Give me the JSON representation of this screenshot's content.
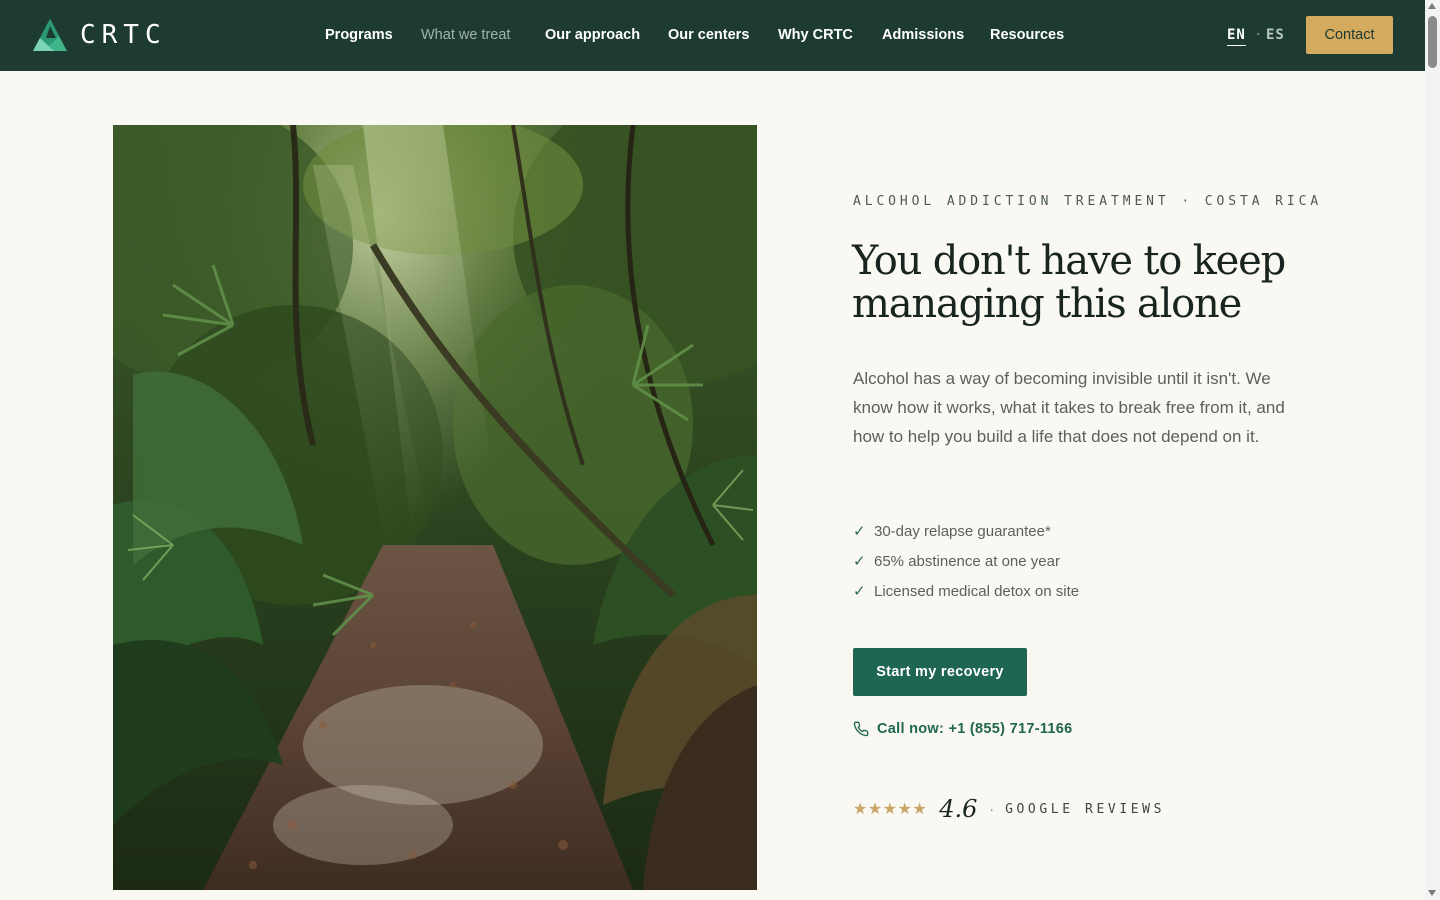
{
  "brand": {
    "name": "CRTC",
    "logo_icon": "leaf-triangle-logo-icon"
  },
  "nav": {
    "items": [
      {
        "label": "Programs",
        "state": "normal"
      },
      {
        "label": "What we treat",
        "state": "muted"
      },
      {
        "label": "Our approach",
        "state": "normal"
      },
      {
        "label": "Our centers",
        "state": "normal"
      },
      {
        "label": "Why CRTC",
        "state": "normal"
      },
      {
        "label": "Admissions",
        "state": "normal"
      },
      {
        "label": "Resources",
        "state": "normal"
      }
    ],
    "language": {
      "active": "EN",
      "separator": "·",
      "other": "ES"
    },
    "contact_label": "Contact"
  },
  "hero": {
    "image": {
      "description_icon": "jungle-path-photo"
    },
    "eyebrow": "ALCOHOL ADDICTION TREATMENT · COSTA RICA",
    "headline": "You don't have to keep managing this alone",
    "intro": "Alcohol has a way of becoming invisible until it isn't. We know how it works, what it takes to break free from it, and how to help you build a life that does not depend on it.",
    "checklist": [
      {
        "icon": "check-icon",
        "text": "30-day relapse guarantee*"
      },
      {
        "icon": "check-icon",
        "text": "65% abstinence at one year"
      },
      {
        "icon": "check-icon",
        "text": "Licensed medical detox on site"
      }
    ],
    "cta_label": "Start my recovery",
    "call": {
      "icon": "phone-icon",
      "label": "Call now: +1 (855) 717-1166"
    },
    "rating": {
      "stars": "★★★★★",
      "value": "4.6",
      "separator": "·",
      "source": "GOOGLE REVIEWS"
    }
  },
  "colors": {
    "nav_bg": "#1d3b32",
    "accent_gold": "#d4aa5f",
    "cta_green": "#1f6652",
    "page_bg": "#faf8f2"
  }
}
